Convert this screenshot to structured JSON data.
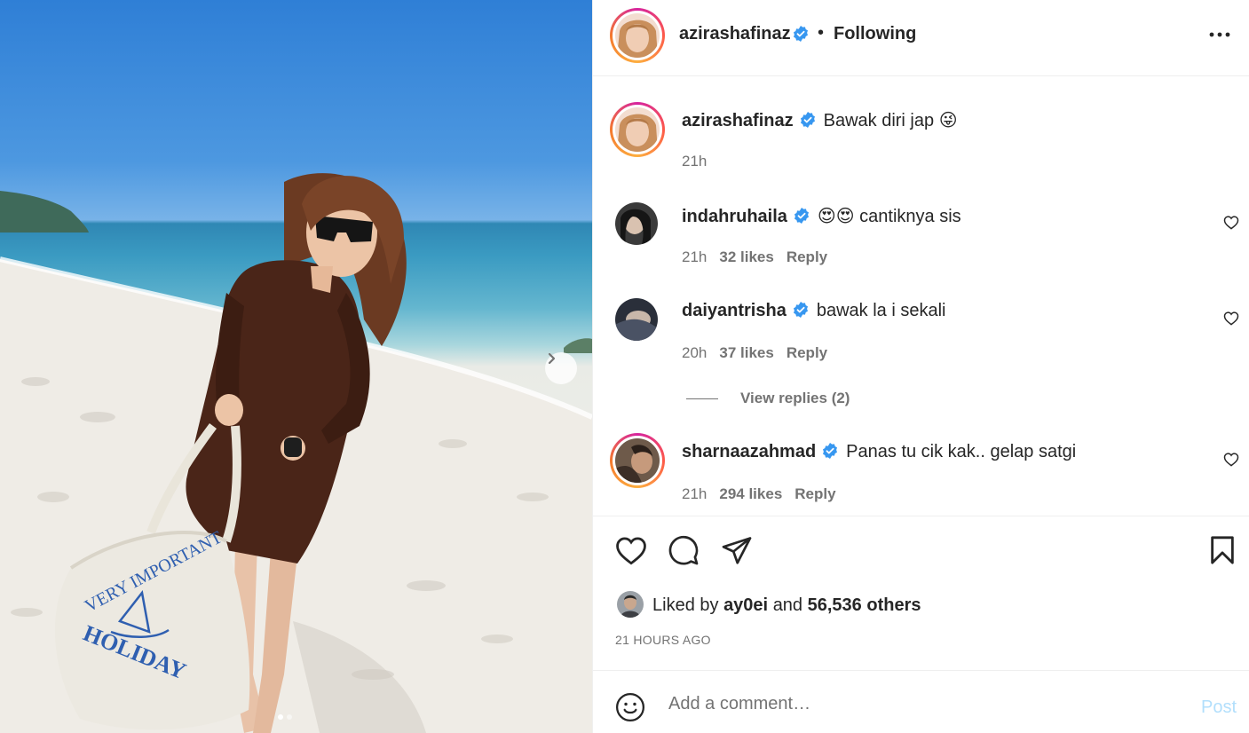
{
  "colors": {
    "accent": "#0095f6",
    "post_disabled": "#b2dffc",
    "text": "#262626",
    "secondary": "#737373",
    "verified": "#3797f0"
  },
  "photo": {
    "description_icon": "beach-photo",
    "bag_text_top": "VERY IMPORTANT",
    "bag_text_bottom": "HOLIDAY",
    "next_icon": "chevron-right-icon"
  },
  "header": {
    "username": "azirashafinaz",
    "separator": "•",
    "follow_label": "Following",
    "more_icon": "more-horizontal-icon"
  },
  "caption": {
    "username": "azirashafinaz",
    "text": "Bawak diri jap",
    "emoji": "😜",
    "time": "21h"
  },
  "comments": [
    {
      "username": "indahruhaila",
      "emoji": "😍😍",
      "text": "cantiknya sis",
      "time": "21h",
      "likes": "32 likes",
      "reply": "Reply"
    },
    {
      "username": "daiyantrisha",
      "emoji": "",
      "text": "bawak la i sekali",
      "time": "20h",
      "likes": "37 likes",
      "reply": "Reply",
      "view_replies": "View replies (2)"
    },
    {
      "username": "sharnaazahmad",
      "emoji": "",
      "text": "Panas tu cik kak.. gelap satgi",
      "time": "21h",
      "likes": "294 likes",
      "reply": "Reply"
    }
  ],
  "likes": {
    "prefix": "Liked by",
    "user": "ay0ei",
    "and": "and",
    "others": "56,536 others"
  },
  "timestamp": "21 HOURS AGO",
  "composer": {
    "placeholder": "Add a comment…",
    "post_label": "Post",
    "emoji_icon": "smiley-icon"
  }
}
